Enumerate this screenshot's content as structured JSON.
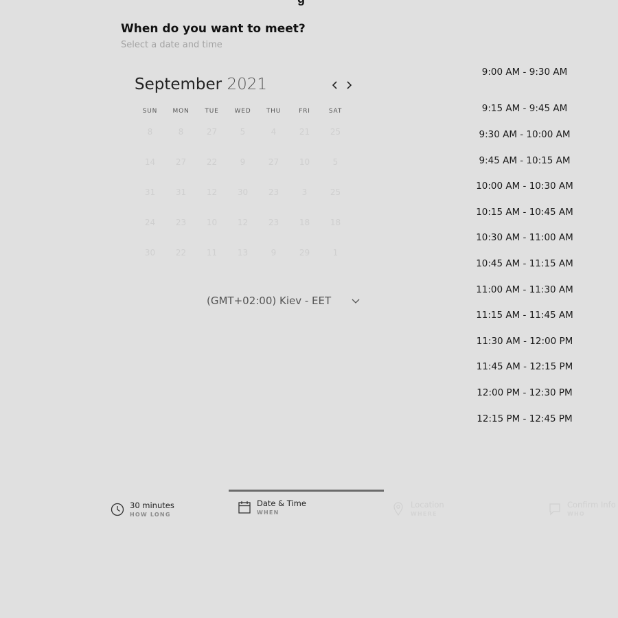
{
  "header": {
    "title_fragment": "g",
    "question": "When do you want to meet?",
    "subtitle": "Select a date and time"
  },
  "calendar": {
    "month": "September",
    "year": "2021",
    "weekdays": [
      "SUN",
      "MON",
      "TUE",
      "WED",
      "THU",
      "FRI",
      "SAT"
    ],
    "weeks": [
      [
        "8",
        "8",
        "27",
        "5",
        "4",
        "21",
        "25"
      ],
      [
        "14",
        "27",
        "22",
        "9",
        "27",
        "10",
        "5"
      ],
      [
        "31",
        "31",
        "12",
        "30",
        "23",
        "3",
        "25"
      ],
      [
        "24",
        "23",
        "10",
        "12",
        "23",
        "18",
        "18"
      ],
      [
        "30",
        "22",
        "11",
        "13",
        "9",
        "29",
        "1"
      ]
    ]
  },
  "timezone": {
    "label": "(GMT+02:00) Kiev - EET"
  },
  "time_slots": [
    "9:00 AM - 9:30 AM",
    "9:15 AM - 9:45 AM",
    "9:30 AM - 10:00 AM",
    "9:45 AM - 10:15 AM",
    "10:00 AM - 10:30 AM",
    "10:15 AM - 10:45 AM",
    "10:30 AM - 11:00 AM",
    "10:45 AM - 11:15 AM",
    "11:00 AM - 11:30 AM",
    "11:15 AM - 11:45 AM",
    "11:30 AM - 12:00 PM",
    "11:45 AM - 12:15 PM",
    "12:00 PM - 12:30 PM",
    "12:15 PM - 12:45 PM"
  ],
  "steps": {
    "how_long": {
      "label": "30 minutes",
      "sub": "HOW LONG",
      "icon": "clock-icon"
    },
    "when": {
      "label": "Date & Time",
      "sub": "WHEN",
      "icon": "calendar-icon"
    },
    "where": {
      "label": "Location",
      "sub": "WHERE",
      "icon": "location-pin-icon"
    },
    "who": {
      "label": "Confirm Info",
      "sub": "WHO",
      "icon": "chat-bubble-icon"
    }
  },
  "colors": {
    "background": "#e0e0e0",
    "active_step_bar": "#6b6b6b",
    "disabled_text": "#cfcfcf"
  }
}
